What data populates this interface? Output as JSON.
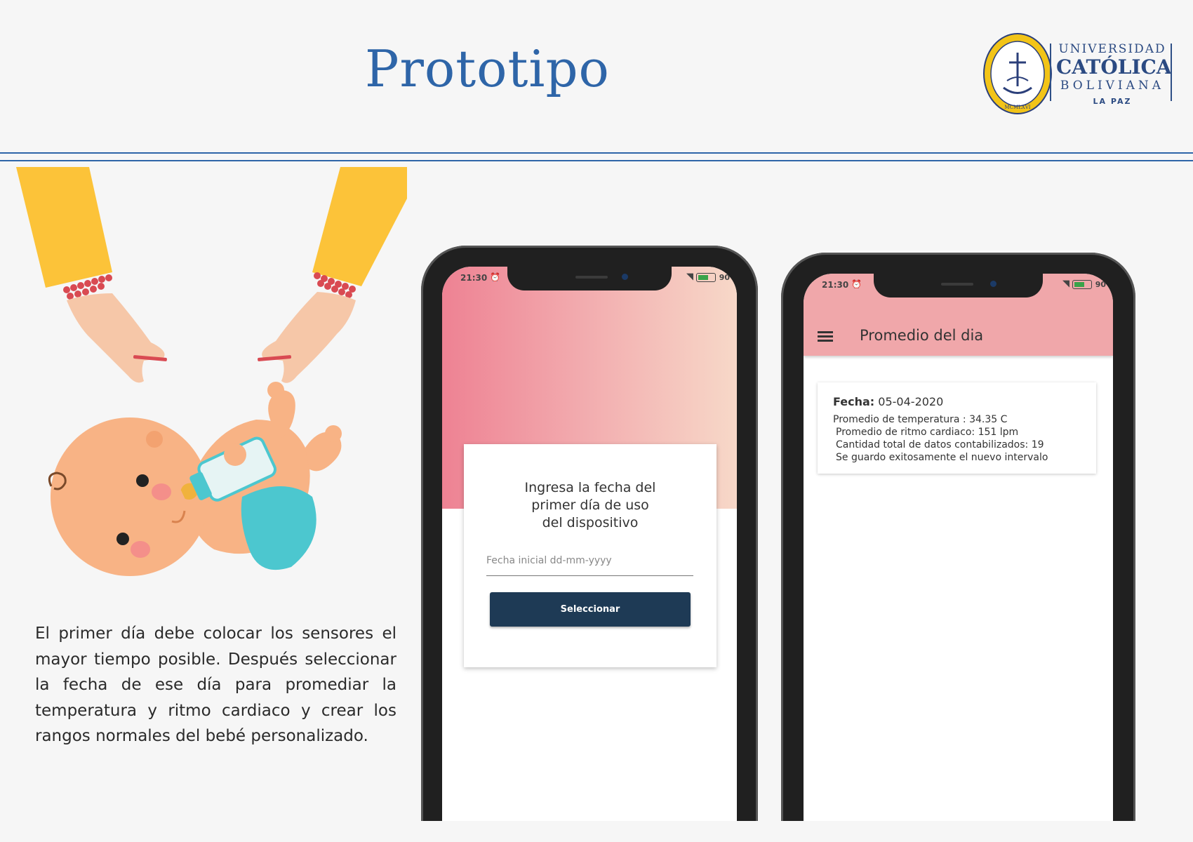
{
  "header": {
    "title": "Prototipo",
    "university": {
      "line1": "UNIVERSIDAD",
      "line2": "CATÓLICA",
      "line3": "BOLIVIANA",
      "line4": "LA PAZ",
      "seal_text": "MCMLXVI"
    }
  },
  "description": "El primer día debe colocar los sensores el mayor tiempo posible. Después seleccionar la fecha de ese día para promediar la temperatura y ritmo cardiaco y crear los rangos normales del bebé personalizado.",
  "phone1": {
    "status": {
      "time": "21:30",
      "battery": "90"
    },
    "card_title": "Ingresa la fecha del\nprimer día de uso\ndel dispositivo",
    "date_placeholder": "Fecha inicial dd-mm-yyyy",
    "button_label": "Seleccionar"
  },
  "phone2": {
    "status": {
      "time": "21:30",
      "battery": "90"
    },
    "app_title": "Promedio del dia",
    "result": {
      "date_label": "Fecha:",
      "date_value": "05-04-2020",
      "temperature": "Promedio de temperatura : 34.35 C",
      "heart_rate": "Promedio de ritmo cardiaco: 151 lpm",
      "data_count": "Cantidad total de datos contabilizados: 19",
      "saved_msg": "Se guardo exitosamente el nuevo intervalo"
    }
  },
  "colors": {
    "brand_blue": "#2e65a8",
    "button_navy": "#1e3a55",
    "app_bar_pink": "#f0a7aa"
  }
}
